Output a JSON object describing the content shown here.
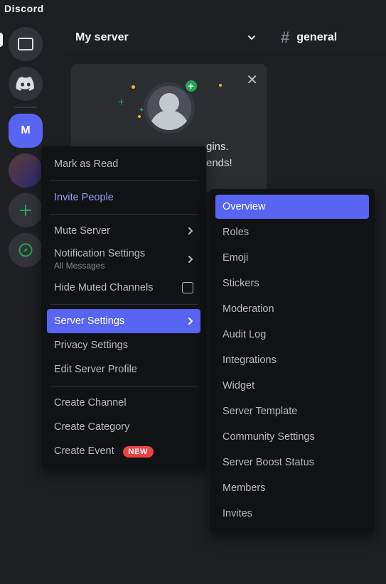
{
  "app_title": "Discord",
  "header": {
    "server_name": "My server",
    "channel_name": "general"
  },
  "server_list": {
    "active_initial": "M"
  },
  "invite": {
    "line1_fragment": "gins.",
    "line2_fragment": "ends!"
  },
  "context_menu": {
    "mark_as_read": "Mark as Read",
    "invite_people": "Invite People",
    "mute_server": "Mute Server",
    "notification_settings": "Notification Settings",
    "notification_sub": "All Messages",
    "hide_muted": "Hide Muted Channels",
    "server_settings": "Server Settings",
    "privacy_settings": "Privacy Settings",
    "edit_server_profile": "Edit Server Profile",
    "create_channel": "Create Channel",
    "create_category": "Create Category",
    "create_event": "Create Event",
    "new_badge": "NEW"
  },
  "submenu": {
    "items": [
      "Overview",
      "Roles",
      "Emoji",
      "Stickers",
      "Moderation",
      "Audit Log",
      "Integrations",
      "Widget",
      "Server Template",
      "Community Settings",
      "Server Boost Status",
      "Members",
      "Invites"
    ]
  }
}
